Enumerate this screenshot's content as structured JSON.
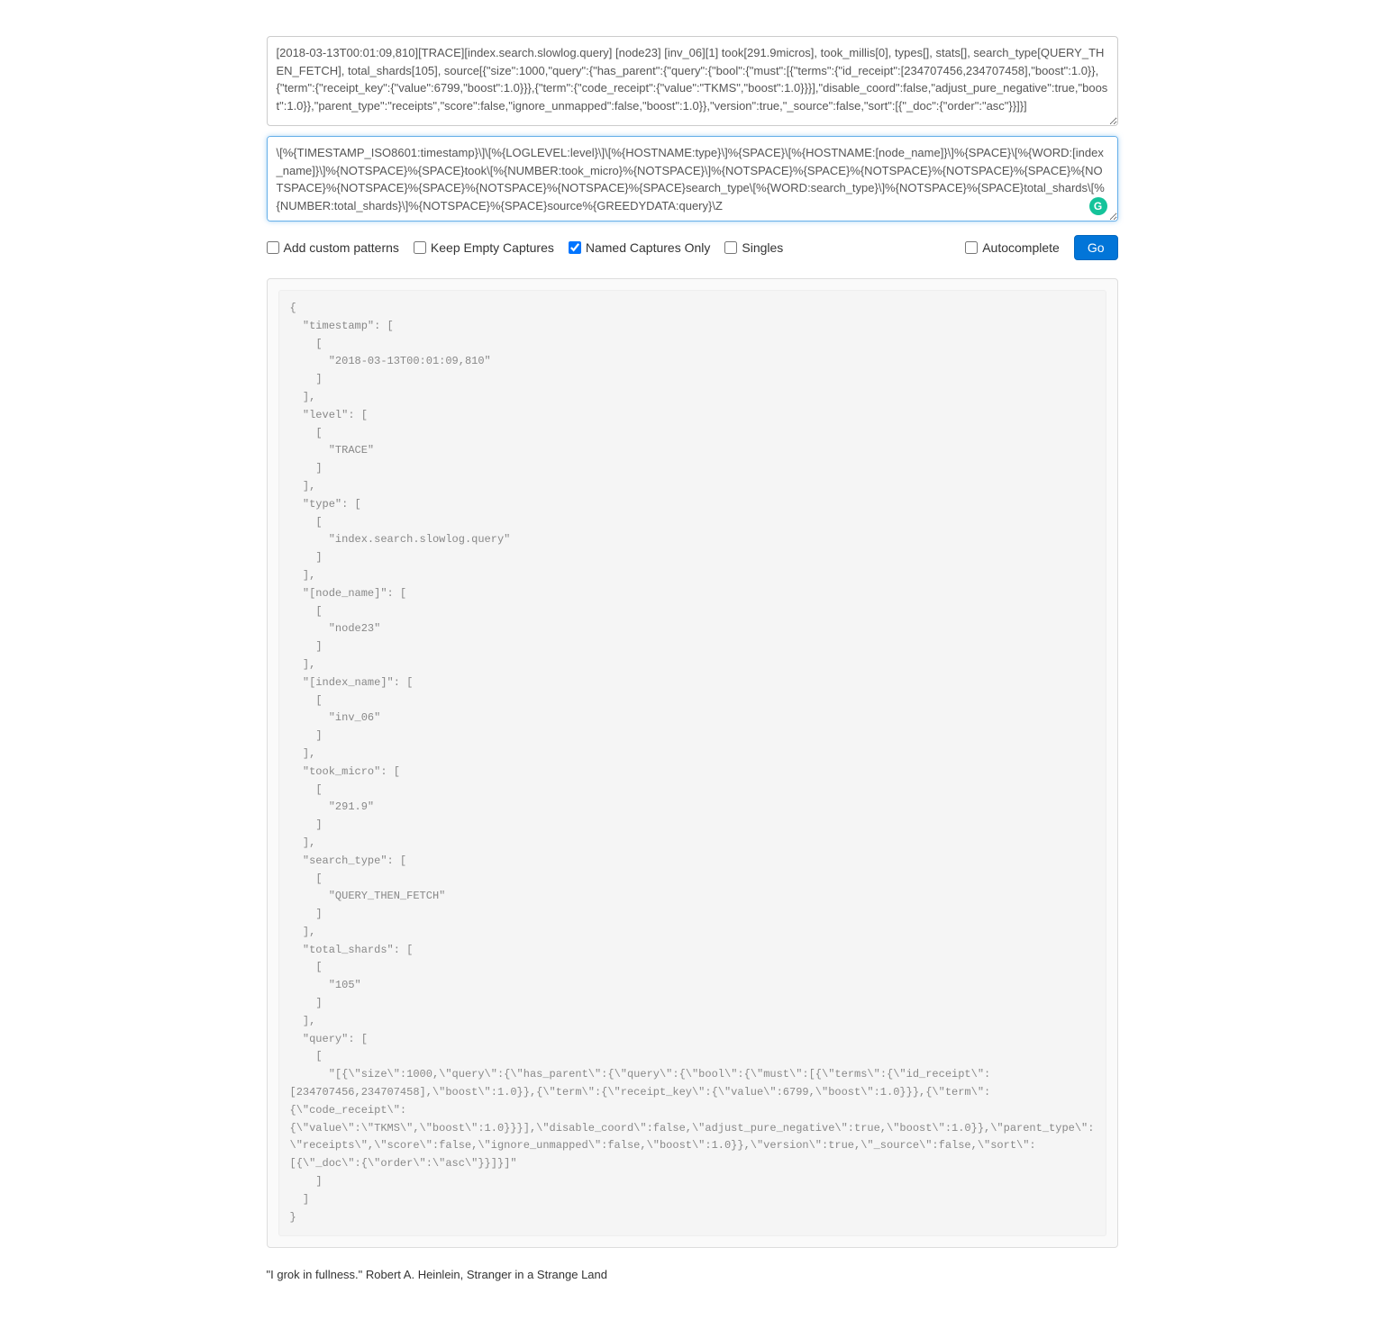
{
  "inputs": {
    "log_sample": "[2018-03-13T00:01:09,810][TRACE][index.search.slowlog.query] [node23] [inv_06][1] took[291.9micros], took_millis[0], types[], stats[], search_type[QUERY_THEN_FETCH], total_shards[105], source[{\"size\":1000,\"query\":{\"has_parent\":{\"query\":{\"bool\":{\"must\":[{\"terms\":{\"id_receipt\":[234707456,234707458],\"boost\":1.0}},{\"term\":{\"receipt_key\":{\"value\":6799,\"boost\":1.0}}},{\"term\":{\"code_receipt\":{\"value\":\"TKMS\",\"boost\":1.0}}}],\"disable_coord\":false,\"adjust_pure_negative\":true,\"boost\":1.0}},\"parent_type\":\"receipts\",\"score\":false,\"ignore_unmapped\":false,\"boost\":1.0}},\"version\":true,\"_source\":false,\"sort\":[{\"_doc\":{\"order\":\"asc\"}}]}]",
    "pattern": "\\[%{TIMESTAMP_ISO8601:timestamp}\\]\\[%{LOGLEVEL:level}\\]\\[%{HOSTNAME:type}\\]%{SPACE}\\[%{HOSTNAME:[node_name]}\\]%{SPACE}\\[%{WORD:[index_name]}\\]%{NOTSPACE}%{SPACE}took\\[%{NUMBER:took_micro}%{NOTSPACE}\\]%{NOTSPACE}%{SPACE}%{NOTSPACE}%{NOTSPACE}%{SPACE}%{NOTSPACE}%{NOTSPACE}%{SPACE}%{NOTSPACE}%{NOTSPACE}%{SPACE}search_type\\[%{WORD:search_type}\\]%{NOTSPACE}%{SPACE}total_shards\\[%{NUMBER:total_shards}\\]%{NOTSPACE}%{SPACE}source%{GREEDYDATA:query}\\Z"
  },
  "options": {
    "add_custom_patterns": {
      "label": "Add custom patterns",
      "checked": false
    },
    "keep_empty_captures": {
      "label": "Keep Empty Captures",
      "checked": false
    },
    "named_captures_only": {
      "label": "Named Captures Only",
      "checked": true
    },
    "singles": {
      "label": "Singles",
      "checked": false
    },
    "autocomplete": {
      "label": "Autocomplete",
      "checked": false
    },
    "go_button": "Go"
  },
  "output_json": "{\n  \"timestamp\": [\n    [\n      \"2018-03-13T00:01:09,810\"\n    ]\n  ],\n  \"level\": [\n    [\n      \"TRACE\"\n    ]\n  ],\n  \"type\": [\n    [\n      \"index.search.slowlog.query\"\n    ]\n  ],\n  \"[node_name]\": [\n    [\n      \"node23\"\n    ]\n  ],\n  \"[index_name]\": [\n    [\n      \"inv_06\"\n    ]\n  ],\n  \"took_micro\": [\n    [\n      \"291.9\"\n    ]\n  ],\n  \"search_type\": [\n    [\n      \"QUERY_THEN_FETCH\"\n    ]\n  ],\n  \"total_shards\": [\n    [\n      \"105\"\n    ]\n  ],\n  \"query\": [\n    [\n      \"[{\\\"size\\\":1000,\\\"query\\\":{\\\"has_parent\\\":{\\\"query\\\":{\\\"bool\\\":{\\\"must\\\":[{\\\"terms\\\":{\\\"id_receipt\\\":[234707456,234707458],\\\"boost\\\":1.0}},{\\\"term\\\":{\\\"receipt_key\\\":{\\\"value\\\":6799,\\\"boost\\\":1.0}}},{\\\"term\\\":{\\\"code_receipt\\\":{\\\"value\\\":\\\"TKMS\\\",\\\"boost\\\":1.0}}}],\\\"disable_coord\\\":false,\\\"adjust_pure_negative\\\":true,\\\"boost\\\":1.0}},\\\"parent_type\\\":\\\"receipts\\\",\\\"score\\\":false,\\\"ignore_unmapped\\\":false,\\\"boost\\\":1.0}},\\\"version\\\":true,\\\"_source\\\":false,\\\"sort\\\":[{\\\"_doc\\\":{\\\"order\\\":\\\"asc\\\"}}]}]\"\n    ]\n  ]\n}",
  "footer": {
    "quote": "\"I grok in fullness.\" Robert A. Heinlein, Stranger in a Strange Land"
  }
}
